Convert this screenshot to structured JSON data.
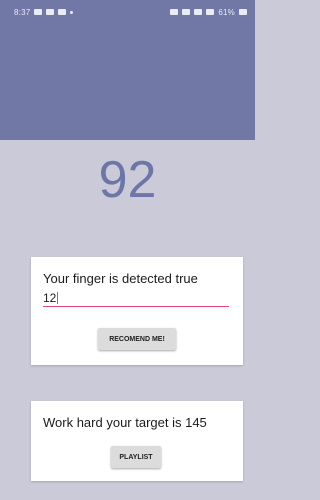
{
  "status_bar": {
    "time": "8:37",
    "battery": "61%"
  },
  "heart_rate": {
    "value": "92"
  },
  "detection_card": {
    "message": "Your finger is detected true",
    "input_value": "12",
    "button_label": "RECOMEND ME!"
  },
  "target_card": {
    "message": "Work hard your target is 145",
    "button_label": "PLAYLIST"
  },
  "colors": {
    "header": "#7178a6",
    "background": "#cacad8",
    "accent": "#e0477b"
  }
}
